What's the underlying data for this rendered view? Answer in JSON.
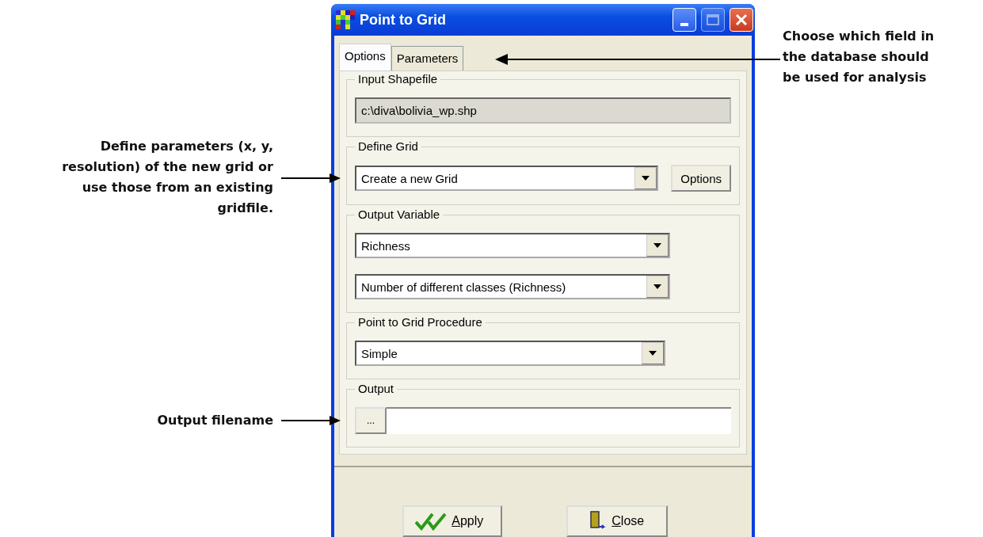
{
  "window": {
    "title": "Point to Grid"
  },
  "tabs": [
    {
      "label": "Options",
      "selected": true
    },
    {
      "label": "Parameters",
      "selected": false
    }
  ],
  "groups": [
    {
      "title": "Input Shapefile",
      "controls": [
        {
          "kind": "readonly",
          "value": "c:\\diva\\bolivia_wp.shp"
        }
      ]
    },
    {
      "title": "Define Grid",
      "controls": [
        {
          "kind": "dropdown",
          "value": "Create a new Grid",
          "button": "Options"
        }
      ]
    },
    {
      "title": "Output Variable",
      "controls": [
        {
          "kind": "dropdown",
          "value": "Richness"
        },
        {
          "kind": "dropdown",
          "value": "Number of different classes (Richness)"
        }
      ]
    },
    {
      "title": "Point to Grid Procedure",
      "controls": [
        {
          "kind": "dropdown",
          "value": "Simple"
        }
      ]
    },
    {
      "title": "Output",
      "controls": [
        {
          "kind": "file",
          "button": "..."
        }
      ]
    }
  ],
  "buttons": [
    {
      "kind": "apply",
      "label": "Apply"
    },
    {
      "kind": "close",
      "label": "Close"
    }
  ],
  "annotations": [
    {
      "kind": "right",
      "lines": [
        "Choose which field in",
        "the database should",
        "be used for analysis"
      ]
    },
    {
      "kind": "left",
      "lines": [
        "Define parameters (x, y,",
        "resolution) of the new grid or",
        "use those from an existing",
        "gridfile."
      ]
    },
    {
      "kind": "left",
      "lines": [
        "Output filename"
      ]
    }
  ]
}
